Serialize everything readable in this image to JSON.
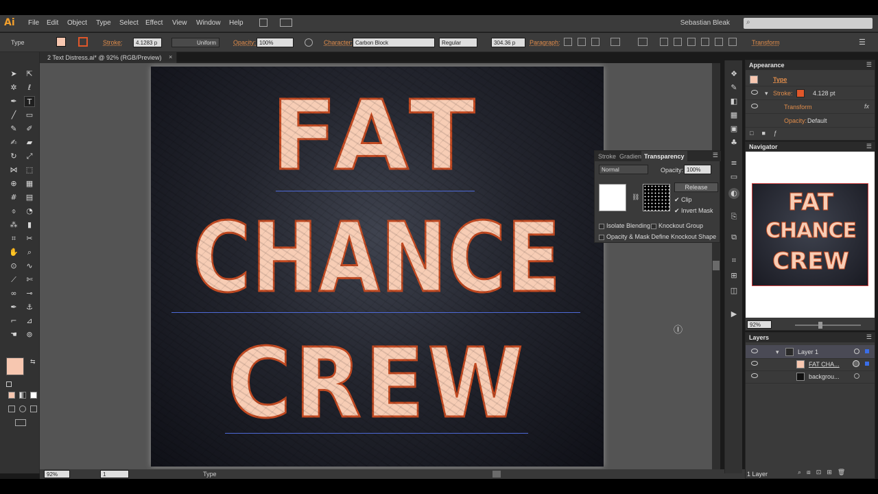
{
  "app": {
    "logo": "Ai",
    "user": "Sebastian Bleak"
  },
  "menu": [
    "File",
    "Edit",
    "Object",
    "Type",
    "Select",
    "Effect",
    "View",
    "Window",
    "Help"
  ],
  "control_bar": {
    "mode": "Type",
    "stroke_label": "Stroke:",
    "stroke_weight": "4.1283 p",
    "stroke_profile": "Uniform",
    "opacity_label": "Opacity:",
    "opacity_value": "100%",
    "character_label": "Character:",
    "font": "Carbon Block",
    "font_style": "Regular",
    "font_size": "304.36 p",
    "paragraph_label": "Paragraph:",
    "transform_label": "Transform",
    "fill_color": "#f7c7b0",
    "stroke_color": "#e0572a"
  },
  "document": {
    "tab_title": "2 Text Distress.ai* @ 92% (RGB/Preview)"
  },
  "artwork": {
    "lines": [
      "FAT",
      "CHANCE",
      "CREW"
    ]
  },
  "statusbar": {
    "zoom": "92%",
    "page": "1",
    "tool": "Type"
  },
  "appearance": {
    "title": "Appearance",
    "object": "Type",
    "stroke_label": "Stroke:",
    "stroke_value": "4.128 pt",
    "transform": "Transform",
    "opacity_label": "Opacity:",
    "opacity_value": "Default",
    "fx": "fx"
  },
  "navigator": {
    "title": "Navigator",
    "zoom": "92%"
  },
  "layers": {
    "title": "Layers",
    "rows": [
      {
        "name": "Layer 1"
      },
      {
        "name": "FAT CHA..."
      },
      {
        "name": "backgrou..."
      }
    ],
    "footer": "1 Layer"
  },
  "transparency": {
    "tabs": [
      "Stroke",
      "Gradien",
      "Transparency"
    ],
    "blend_mode": "Normal",
    "opacity_label": "Opacity:",
    "opacity_value": "100%",
    "release": "Release",
    "clip": "Clip",
    "invert_mask": "Invert Mask",
    "isolate": "Isolate Blending",
    "knockout": "Knockout Group",
    "opacity_mask_define": "Opacity & Mask Define Knockout Shape"
  },
  "colors": {
    "accent": "#e28d4b",
    "text_fill": "#f7cdb5",
    "text_stroke": "#c24a22",
    "guide": "#4e6ad8"
  }
}
